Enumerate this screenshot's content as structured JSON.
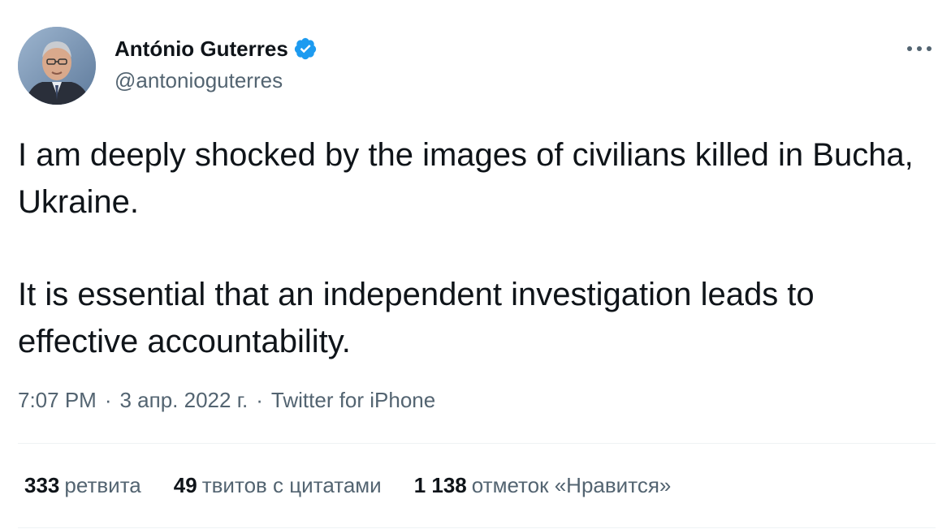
{
  "author": {
    "display_name": "António Guterres",
    "handle": "@antonioguterres",
    "verified": true,
    "avatar_icon": "profile-photo"
  },
  "tweet": {
    "paragraphs": [
      "I am deeply shocked by the images of civilians killed in Bucha, Ukraine.",
      "It is essential that an independent investigation leads to effective accountability."
    ],
    "time": "7:07 PM",
    "date": "3 апр. 2022 г.",
    "source": "Twitter for iPhone",
    "separator": "·"
  },
  "stats": [
    {
      "count": "333",
      "label": "ретвита"
    },
    {
      "count": "49",
      "label": "твитов с цитатами"
    },
    {
      "count": "1 138",
      "label": "отметок «Нравится»"
    }
  ],
  "colors": {
    "text_primary": "#0f1419",
    "text_secondary": "#536471",
    "verified_blue": "#1d9bf0",
    "divider": "#eff3f4"
  }
}
